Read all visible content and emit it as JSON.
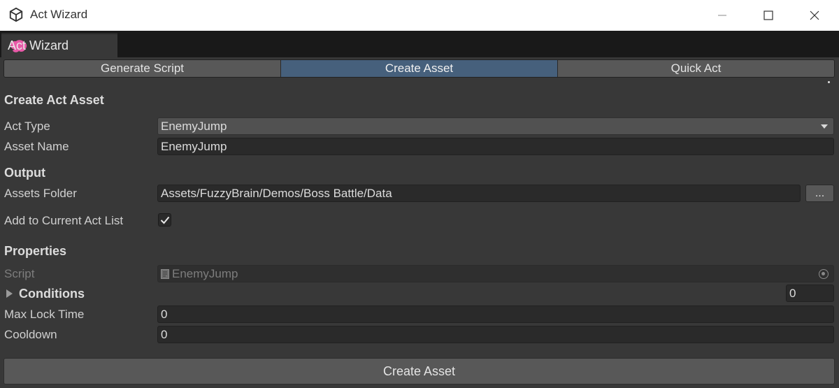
{
  "window": {
    "title": "Act Wizard",
    "controls": [
      "minimize",
      "maximize",
      "close"
    ]
  },
  "dock": {
    "tab_label": "Act Wizard",
    "tab_icon": "brain-icon",
    "menu_icon": "kebab-menu-icon"
  },
  "toolbar": {
    "tabs": [
      {
        "label": "Generate Script",
        "active": false
      },
      {
        "label": "Create Asset",
        "active": true
      },
      {
        "label": "Quick Act",
        "active": false
      }
    ]
  },
  "form": {
    "heading": "Create Act Asset",
    "act_type_label": "Act Type",
    "act_type_value": "EnemyJump",
    "asset_name_label": "Asset Name",
    "asset_name_value": "EnemyJump",
    "output_heading": "Output",
    "assets_folder_label": "Assets Folder",
    "assets_folder_value": "Assets/FuzzyBrain/Demos/Boss Battle/Data",
    "browse_label": "...",
    "add_to_list_label": "Add to Current Act List",
    "add_to_list_checked": true,
    "properties_heading": "Properties",
    "script_label": "Script",
    "script_value": "EnemyJump",
    "conditions_label": "Conditions",
    "conditions_count": "0",
    "max_lock_label": "Max Lock Time",
    "max_lock_value": "0",
    "cooldown_label": "Cooldown",
    "cooldown_value": "0"
  },
  "actions": {
    "create_label": "Create Asset"
  },
  "colors": {
    "active_tab": "#46607c",
    "brain_icon": "#e85aa8",
    "panel_bg": "#383838"
  }
}
